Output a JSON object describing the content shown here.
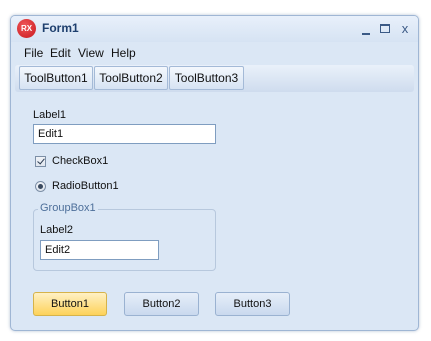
{
  "window": {
    "title": "Form1",
    "app_icon_text": "RX",
    "min_icon": "minimize-icon",
    "max_icon": "maximize-icon",
    "close_icon": "close-icon",
    "close_glyph": "x"
  },
  "menubar": {
    "items": [
      "File",
      "Edit",
      "View",
      "Help"
    ]
  },
  "toolbar": {
    "buttons": [
      "ToolButton1",
      "ToolButton2",
      "ToolButton3"
    ]
  },
  "form": {
    "label1": "Label1",
    "edit1_value": "Edit1",
    "checkbox_label": "CheckBox1",
    "checkbox_checked": true,
    "radio_label": "RadioButton1",
    "radio_selected": true,
    "groupbox": {
      "caption": "GroupBox1",
      "label2": "Label2",
      "edit2_value": "Edit2"
    },
    "buttons": [
      "Button1",
      "Button2",
      "Button3"
    ]
  },
  "colors": {
    "frame": "#dbe7f5",
    "title_text": "#1e3f6e",
    "active_button": "#fdd25a",
    "group_caption": "#4d6f9a"
  }
}
